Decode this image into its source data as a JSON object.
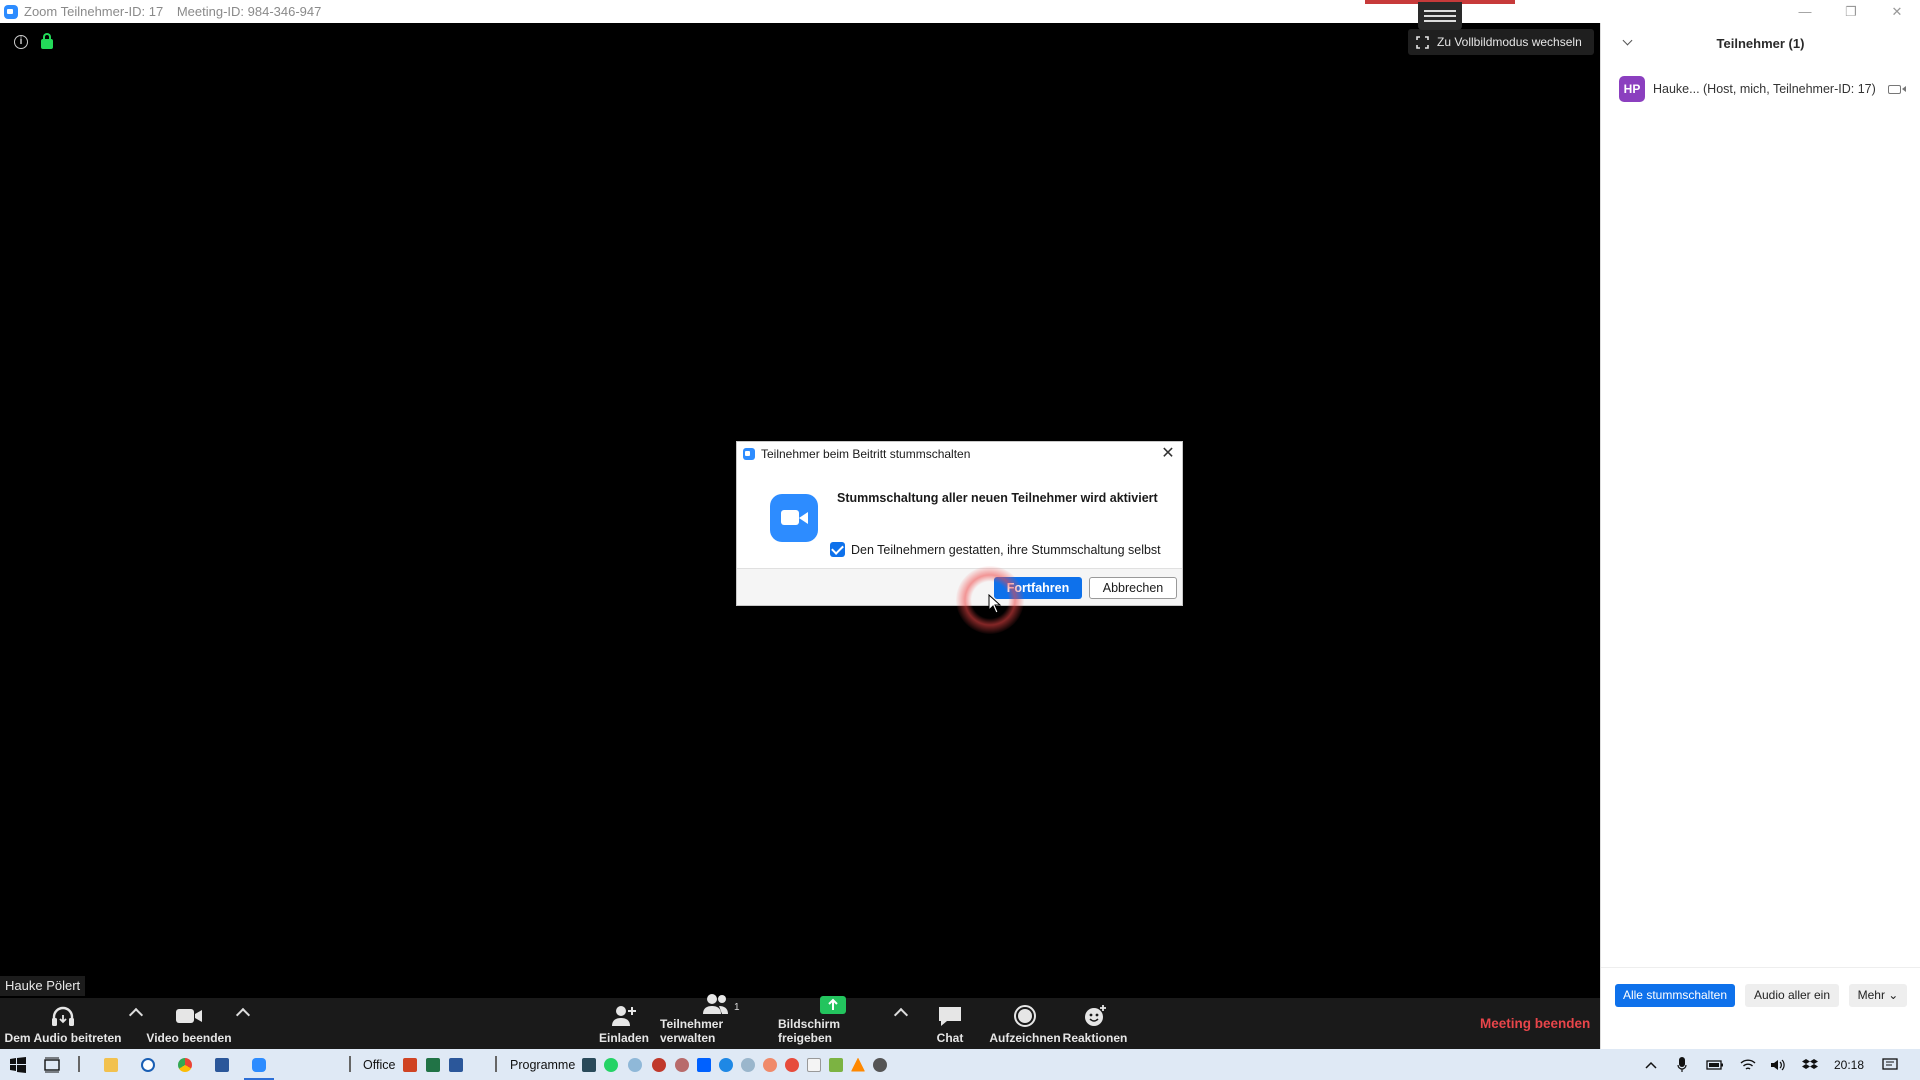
{
  "window": {
    "title_id": "Zoom Teilnehmer-ID: 17",
    "title_meeting": "Meeting-ID: 984-346-947",
    "minimize": "—",
    "restore": "❐",
    "close": "✕"
  },
  "video": {
    "fullscreen_label": "Zu Vollbildmodus wechseln",
    "name_label": "Hauke Pölert"
  },
  "dialog": {
    "title": "Teilnehmer beim Beitritt stummschalten",
    "heading": "Stummschaltung aller neuen Teilnehmer wird aktiviert",
    "checkbox_label": "Den Teilnehmern gestatten, ihre Stummschaltung selbst",
    "primary_label": "Fortfahren",
    "secondary_label": "Abbrechen",
    "close": "✕"
  },
  "toolbar": {
    "audio": "Dem Audio beitreten",
    "video": "Video beenden",
    "invite": "Einladen",
    "participants": "Teilnehmer verwalten",
    "participants_count": "1",
    "share": "Bildschirm freigeben",
    "chat": "Chat",
    "record": "Aufzeichnen",
    "reactions": "Reaktionen",
    "end": "Meeting beenden"
  },
  "panel": {
    "title": "Teilnehmer (1)",
    "participant_initials": "HP",
    "participant_text": "Hauke... (Host, mich, Teilnehmer-ID: 17)",
    "mute_all": "Alle stummschalten",
    "unmute_all": "Audio aller ein",
    "more": "Mehr ⌄"
  },
  "taskbar": {
    "office": "Office",
    "programs": "Programme",
    "time": "20:18"
  },
  "colors": {
    "accent": "#0e71eb",
    "zoom_blue": "#2d8cff",
    "end_red": "#e8454a",
    "avatar_purple": "#8b3fbf",
    "share_green": "#23c45e"
  }
}
